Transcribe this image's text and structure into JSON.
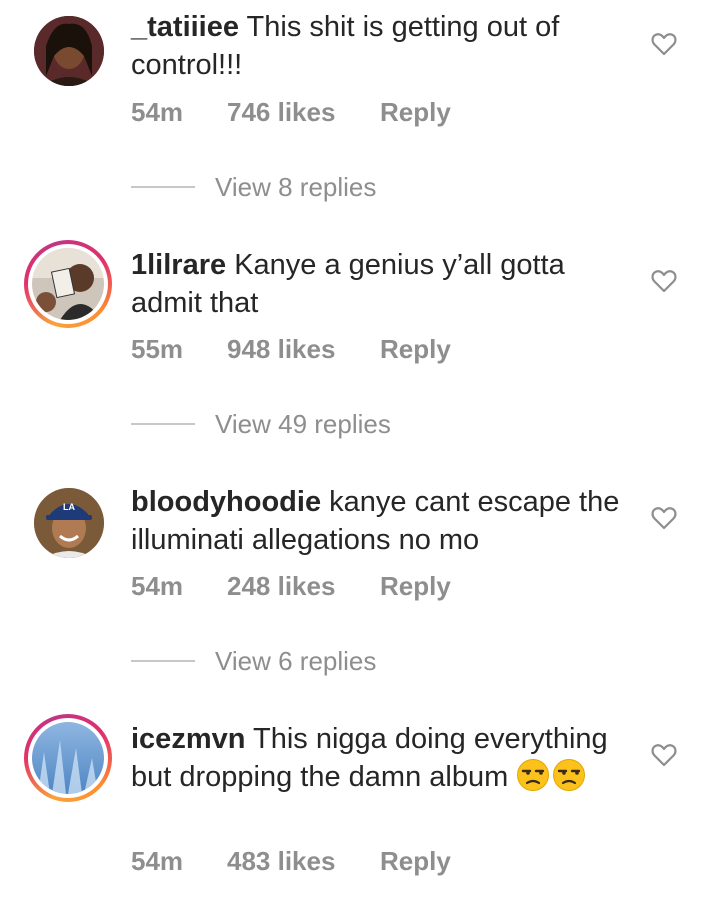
{
  "comments": [
    {
      "username": "_tatiiiee",
      "text": "This shit is getting out of control!!!",
      "time": "54m",
      "likes": "746 likes",
      "reply_label": "Reply",
      "view_replies": "View 8 replies",
      "avatar_ring": false,
      "avatar_icon": "profile-photo"
    },
    {
      "username": "1lilrare",
      "text": "Kanye a genius y’all gotta admit that",
      "time": "55m",
      "likes": "948 likes",
      "reply_label": "Reply",
      "view_replies": "View 49 replies",
      "avatar_ring": true,
      "avatar_icon": "profile-photo"
    },
    {
      "username": "bloodyhoodie",
      "text": "kanye cant escape the illuminati allegations no mo",
      "time": "54m",
      "likes": "248 likes",
      "reply_label": "Reply",
      "view_replies": "View 6 replies",
      "avatar_ring": false,
      "avatar_icon": "profile-photo"
    },
    {
      "username": "icezmvn",
      "text": "This nigga doing everything but dropping the damn album",
      "emoji": "😒😒",
      "time": "54m",
      "likes": "483 likes",
      "reply_label": "Reply",
      "avatar_ring": true,
      "avatar_icon": "profile-photo"
    }
  ],
  "colors": {
    "text": "#262626",
    "muted": "#8e8e8e",
    "divider": "#c7c7c7",
    "story_ring_start": "#f9a23a",
    "story_ring_end": "#c13584"
  },
  "icons": {
    "like": "heart-outline-icon"
  }
}
